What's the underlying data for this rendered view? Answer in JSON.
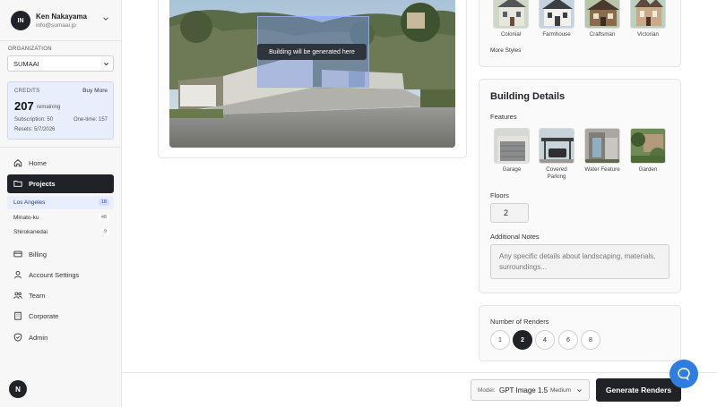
{
  "user": {
    "initials": "IN",
    "name": "Ken Nakayama",
    "email": "info@sumaai.jp"
  },
  "organization": {
    "label": "ORGANIZATION",
    "selected": "SUMAAI"
  },
  "credits": {
    "label": "CREDITS",
    "buy_more": "Buy More",
    "remaining_value": "207",
    "remaining_label": "remaining",
    "subscription": "Subscription: 50",
    "one_time": "One-time: 157",
    "resets": "Resets: 5/7/2026"
  },
  "nav": {
    "home": "Home",
    "projects": "Projects",
    "billing": "Billing",
    "account_settings": "Account Settings",
    "team": "Team",
    "corporate": "Corporate",
    "admin": "Admin"
  },
  "projects": [
    {
      "name": "Los Angeles",
      "count": "18"
    },
    {
      "name": "Minato-ku",
      "count": "48"
    },
    {
      "name": "Shirokanedai",
      "count": "9"
    }
  ],
  "footer_badge": "N",
  "photo": {
    "overlay_label": "Building will be generated here"
  },
  "styles": {
    "items": [
      "Colonial",
      "Farmhouse",
      "Craftsman",
      "Victorian"
    ],
    "more": "More Styles"
  },
  "building_details": {
    "title": "Building Details",
    "features_label": "Features",
    "features": [
      "Garage",
      "Covered Parking",
      "Water Feature",
      "Garden"
    ],
    "floors_label": "Floors",
    "floors_value": "2",
    "notes_label": "Additional Notes",
    "notes_placeholder": "Any specific details about landscaping, materials, surroundings..."
  },
  "renders": {
    "label": "Number of Renders",
    "options": [
      "1",
      "2",
      "4",
      "6",
      "8"
    ],
    "selected": "2"
  },
  "model": {
    "label": "Model:",
    "value": "GPT Image 1.5",
    "quality": "Medium"
  },
  "generate_button": "Generate Renders",
  "colors": {
    "accent": "#1f2328",
    "active_bg": "#e8eefb",
    "chat": "#2f7de1"
  }
}
